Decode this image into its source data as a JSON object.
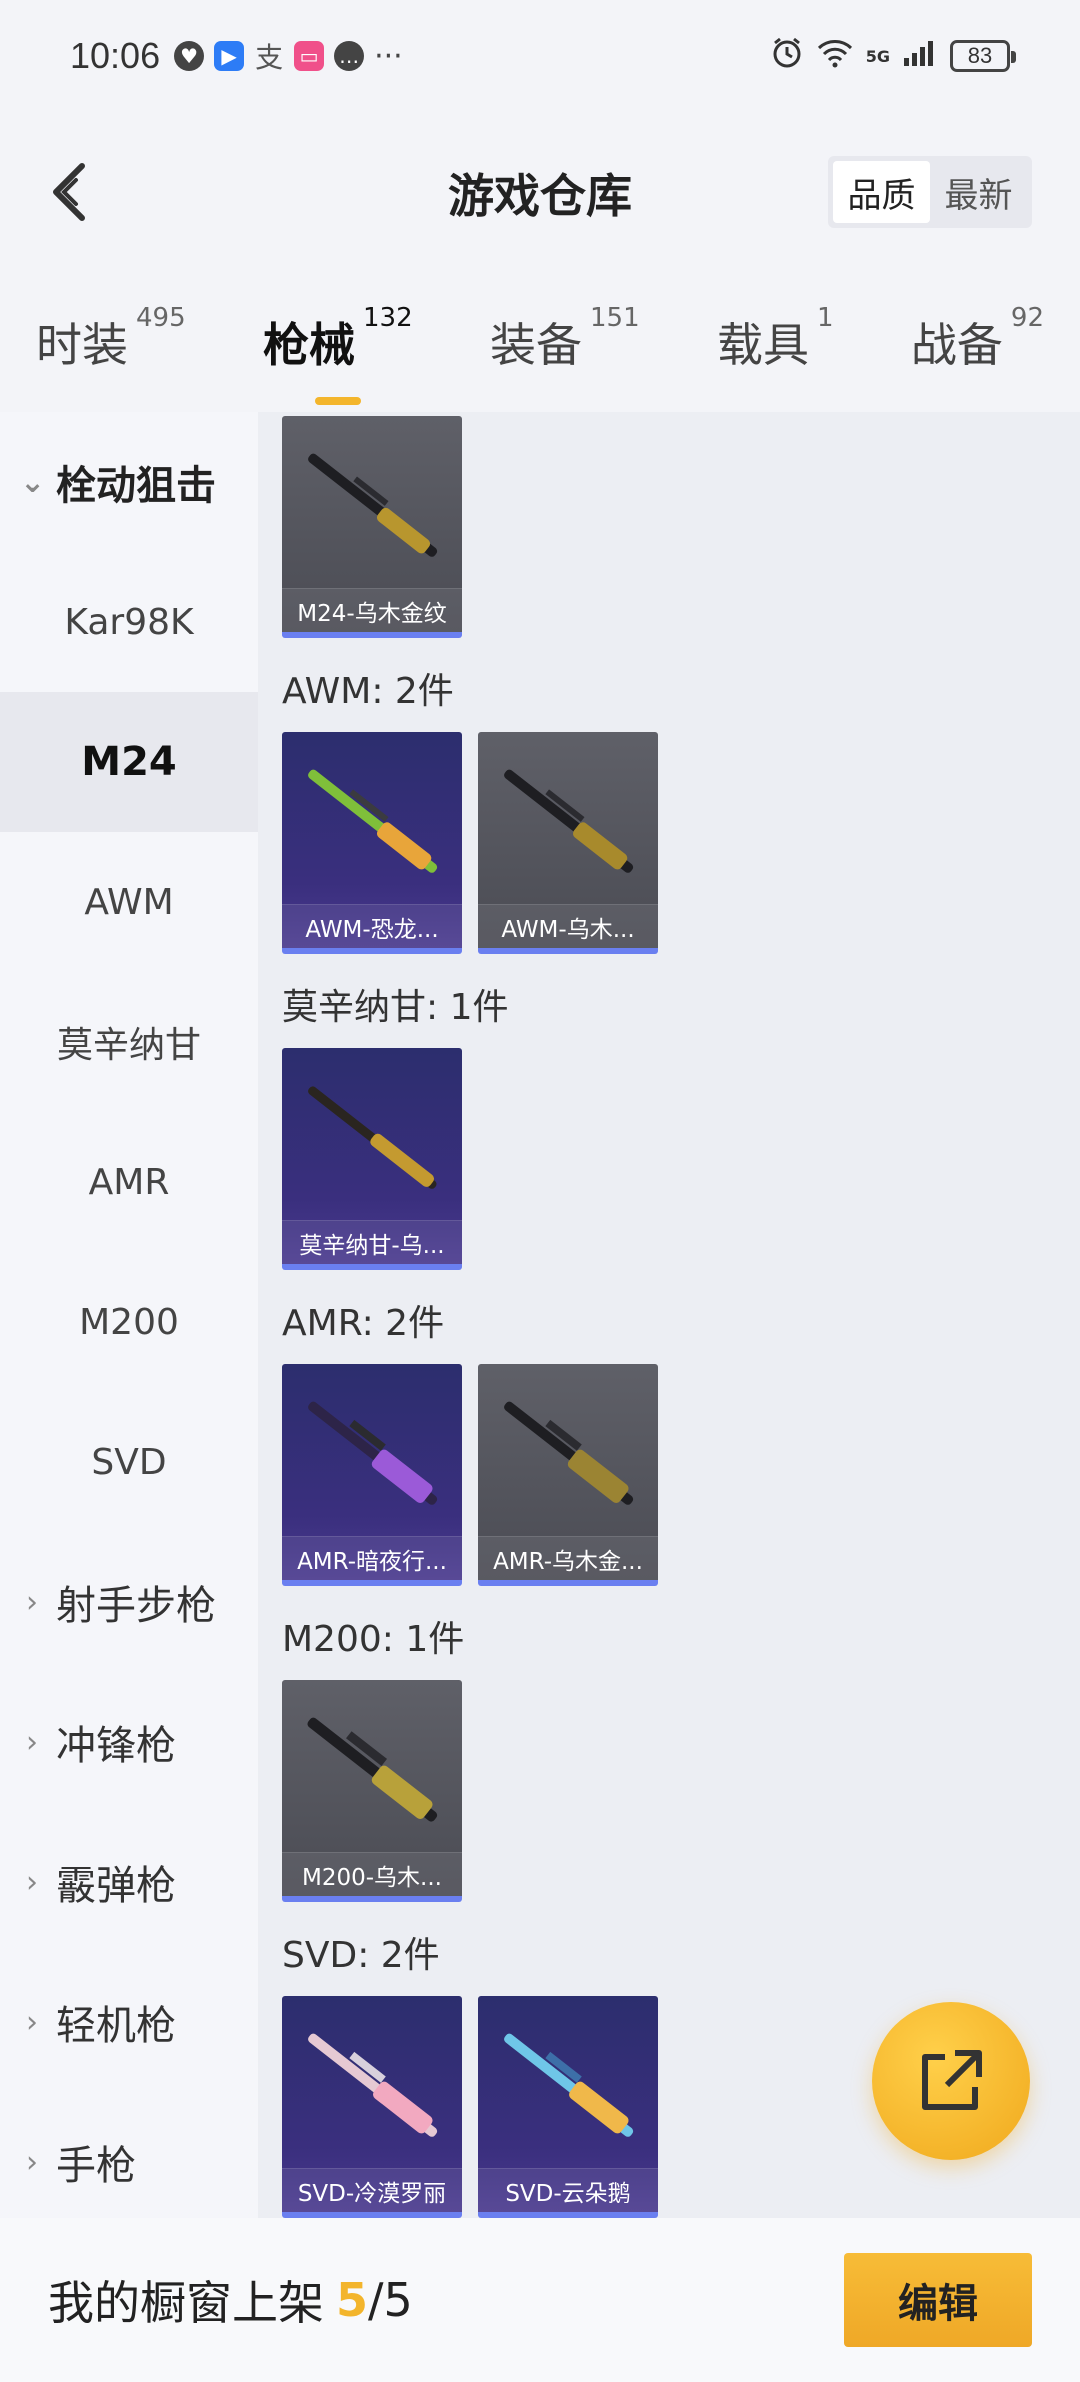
{
  "status_bar": {
    "time": "10:06",
    "battery": "83",
    "network": "5G",
    "icons_left": [
      "heart-badge-icon",
      "app-blue-icon",
      "alipay-icon",
      "app-pink-icon",
      "chat-bubble-icon",
      "more-dots-icon"
    ],
    "icons_right": [
      "alarm-icon",
      "wifi-icon",
      "signal-icon",
      "battery-icon"
    ]
  },
  "header": {
    "title": "游戏仓库",
    "sort_options": [
      "品质",
      "最新"
    ],
    "sort_active": "品质"
  },
  "tabs": [
    {
      "label": "时装",
      "count": "495"
    },
    {
      "label": "枪械",
      "count": "132",
      "active": true
    },
    {
      "label": "装备",
      "count": "151"
    },
    {
      "label": "载具",
      "count": "1"
    },
    {
      "label": "战备",
      "count": "92"
    }
  ],
  "sidebar": {
    "items": [
      {
        "label": "栓动狙击",
        "type": "group",
        "open": true
      },
      {
        "label": "Kar98K",
        "type": "sub"
      },
      {
        "label": "M24",
        "type": "sub",
        "selected": true
      },
      {
        "label": "AWM",
        "type": "sub"
      },
      {
        "label": "莫辛纳甘",
        "type": "sub"
      },
      {
        "label": "AMR",
        "type": "sub"
      },
      {
        "label": "M200",
        "type": "sub"
      },
      {
        "label": "SVD",
        "type": "sub"
      },
      {
        "label": "射手步枪",
        "type": "group"
      },
      {
        "label": "冲锋枪",
        "type": "group"
      },
      {
        "label": "霰弹枪",
        "type": "group"
      },
      {
        "label": "轻机枪",
        "type": "group"
      },
      {
        "label": "手枪",
        "type": "group"
      }
    ]
  },
  "sections": [
    {
      "title": "",
      "items": [
        {
          "name": "M24-乌木金纹",
          "bg": "gray"
        }
      ]
    },
    {
      "title": "AWM: 2件",
      "items": [
        {
          "name": "AWM-恐龙...",
          "bg": "purple"
        },
        {
          "name": "AWM-乌木...",
          "bg": "gray"
        }
      ]
    },
    {
      "title": "莫辛纳甘: 1件",
      "items": [
        {
          "name": "莫辛纳甘-乌...",
          "bg": "purple"
        }
      ]
    },
    {
      "title": "AMR: 2件",
      "items": [
        {
          "name": "AMR-暗夜行...",
          "bg": "purple"
        },
        {
          "name": "AMR-乌木金...",
          "bg": "gray"
        }
      ]
    },
    {
      "title": "M200: 1件",
      "items": [
        {
          "name": "M200-乌木...",
          "bg": "gray"
        }
      ]
    },
    {
      "title": "SVD: 2件",
      "items": [
        {
          "name": "SVD-冷漠罗丽",
          "bg": "purple"
        },
        {
          "name": "SVD-云朵鹅",
          "bg": "purple"
        }
      ]
    }
  ],
  "bottom_bar": {
    "label": "我的橱窗上架",
    "current": "5",
    "separator": "/",
    "total": "5",
    "edit_label": "编辑"
  },
  "colors": {
    "accent": "#f3b52c",
    "card_gray": "#55565e",
    "card_purple": "#2f2f74",
    "card_border": "#6a7ff0"
  }
}
